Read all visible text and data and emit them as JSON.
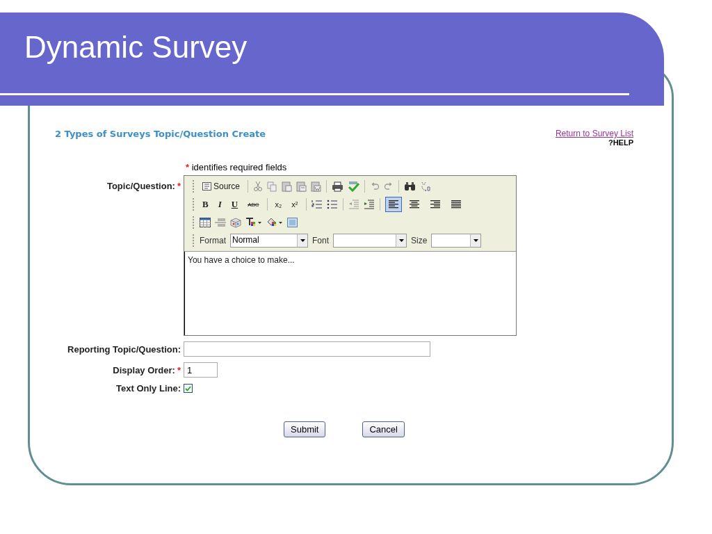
{
  "slide": {
    "title": "Dynamic Survey"
  },
  "page": {
    "heading": "2 Types of Surveys Topic/Question Create",
    "return_link": "Return to Survey List",
    "help_icon_text": "?",
    "help_label": "HELP",
    "required_mark": "*",
    "required_note": "identifies required fields"
  },
  "editor": {
    "label": "Topic/Question:",
    "required": true,
    "source_label": "Source",
    "style_buttons": [
      {
        "kind": "bold",
        "label": "B"
      },
      {
        "kind": "italic",
        "label": "I"
      },
      {
        "kind": "underline",
        "label": "U"
      },
      {
        "kind": "strike",
        "label": "ABC"
      },
      {
        "kind": "sub",
        "label": "x₂"
      },
      {
        "kind": "sup",
        "label": "x²"
      }
    ],
    "alignment_buttons": [
      {
        "selected": true
      },
      {
        "selected": false
      },
      {
        "selected": false
      },
      {
        "selected": false
      }
    ],
    "format": {
      "label": "Format",
      "value": "Normal"
    },
    "font": {
      "label": "Font"
    },
    "size": {
      "label": "Size"
    },
    "content": "You have a choice to make..."
  },
  "fields": [
    {
      "kind": "text",
      "label": "Reporting Topic/Question:",
      "required": false
    },
    {
      "kind": "short-text",
      "label": "Display Order:",
      "required": true,
      "value": "1"
    },
    {
      "kind": "checkbox",
      "label": "Text Only Line:",
      "required": false,
      "checked": true
    }
  ],
  "buttons": [
    "Submit",
    "Cancel"
  ]
}
